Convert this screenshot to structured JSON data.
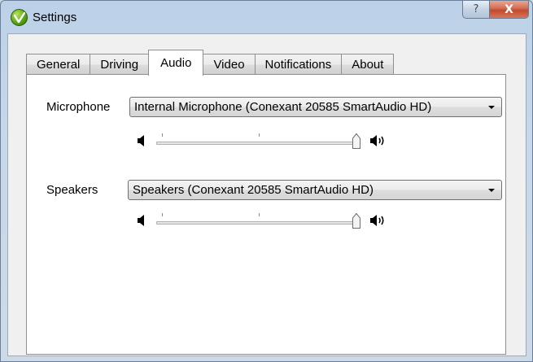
{
  "window": {
    "title": "Settings",
    "help_glyph": "?",
    "close_glyph": "X"
  },
  "tabs": [
    {
      "label": "General",
      "active": false
    },
    {
      "label": "Driving",
      "active": false
    },
    {
      "label": "Audio",
      "active": true
    },
    {
      "label": "Video",
      "active": false
    },
    {
      "label": "Notifications",
      "active": false
    },
    {
      "label": "About",
      "active": false
    }
  ],
  "audio": {
    "microphone": {
      "label": "Microphone",
      "selected": "Internal Microphone (Conexant 20585 SmartAudio HD)",
      "volume_percent": 100
    },
    "speakers": {
      "label": "Speakers",
      "selected": "Speakers (Conexant 20585 SmartAudio HD)",
      "volume_percent": 100
    }
  },
  "icons": {
    "app": "app-logo-icon",
    "volume_low": "speaker-low-icon",
    "volume_high": "speaker-high-icon"
  }
}
